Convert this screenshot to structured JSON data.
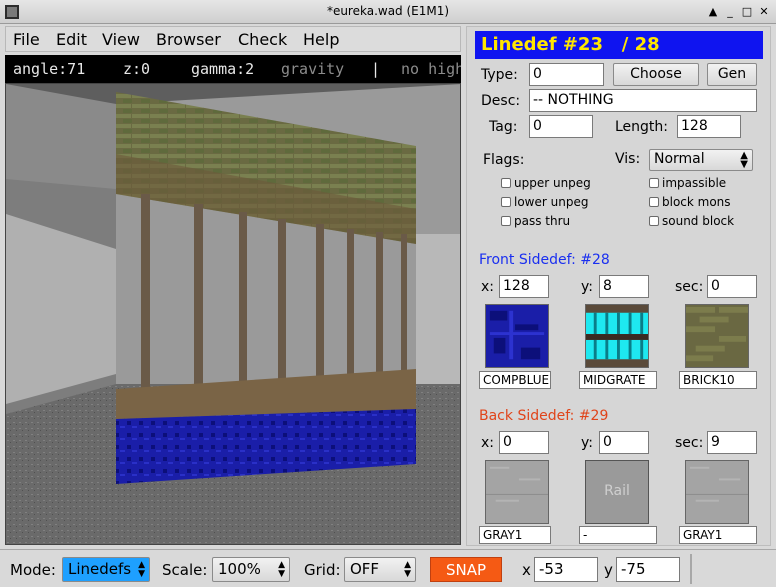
{
  "window": {
    "title": "*eureka.wad (E1M1)"
  },
  "menu": [
    "File",
    "Edit",
    "View",
    "Browser",
    "Check",
    "Help"
  ],
  "infobar": {
    "angle": "angle:71",
    "z": "z:0",
    "gamma": "gamma:2",
    "gravity": "gravity",
    "sep": "|",
    "nohigh": "no high"
  },
  "linedef": {
    "header": "Linedef #23   / 28",
    "type_label": "Type:",
    "type_value": "0",
    "choose": "Choose",
    "gen": "Gen",
    "desc_label": "Desc:",
    "desc_value": "-- NOTHING",
    "tag_label": "Tag:",
    "tag_value": "0",
    "length_label": "Length:",
    "length_value": "128",
    "flags_label": "Flags:",
    "vis_label": "Vis:",
    "vis_value": "Normal",
    "flags": [
      "upper unpeg",
      "lower unpeg",
      "pass thru",
      "impassible",
      "block mons",
      "sound block"
    ]
  },
  "front": {
    "title": "Front Sidedef: #28",
    "x_label": "x:",
    "x": "128",
    "y_label": "y:",
    "y": "8",
    "sec_label": "sec:",
    "sec": "0",
    "upper": "COMPBLUE",
    "mid": "MIDGRATE",
    "lower": "BRICK10"
  },
  "back": {
    "title": "Back Sidedef: #29",
    "x_label": "x:",
    "x": "0",
    "y_label": "y:",
    "y": "0",
    "sec_label": "sec:",
    "sec": "9",
    "upper": "GRAY1",
    "mid": "-",
    "mid_preview": "Rail",
    "lower": "GRAY1"
  },
  "status": {
    "mode_label": "Mode:",
    "mode": "Linedefs",
    "scale_label": "Scale:",
    "scale": "100%",
    "grid_label": "Grid:",
    "grid": "OFF",
    "snap": "SNAP",
    "x_label": "x",
    "x": "-53",
    "y_label": "y",
    "y": "-75"
  },
  "colors": {
    "header_bg": "#0f14f0",
    "header_fg": "#ffe600",
    "front_title": "#1a2ff0",
    "back_title": "#e0441a",
    "snap": "#f55a14",
    "mode_highlight": "#1ea0ff"
  }
}
